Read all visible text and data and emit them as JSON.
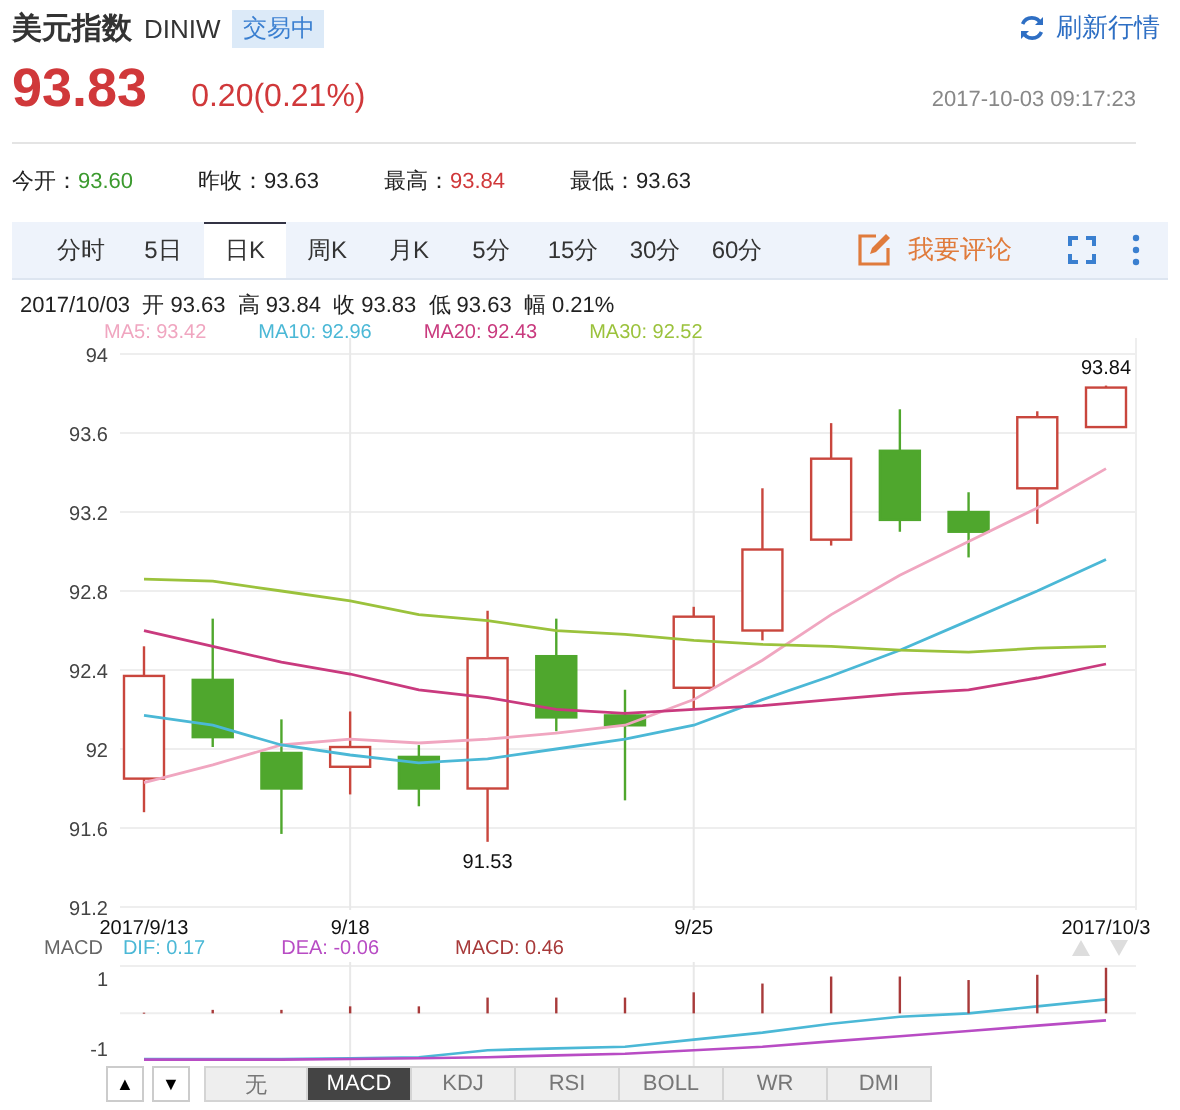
{
  "header": {
    "title": "美元指数",
    "symbol": "DINIW",
    "status": "交易中",
    "refresh": "刷新行情"
  },
  "quote": {
    "price": "93.83",
    "change": "0.20(0.21%)",
    "color": "#d0383a",
    "time": "2017-10-03 09:17:23"
  },
  "stats": [
    {
      "label": "今开：",
      "value": "93.60",
      "color": "#3b9a2e"
    },
    {
      "label": "昨收：",
      "value": "93.63",
      "color": "#222222"
    },
    {
      "label": "最高：",
      "value": "93.84",
      "color": "#d0383a"
    },
    {
      "label": "最低：",
      "value": "93.63",
      "color": "#222222"
    }
  ],
  "period_tabs": [
    {
      "label": "分时",
      "selected": false
    },
    {
      "label": "5日",
      "selected": false
    },
    {
      "label": "日K",
      "selected": true
    },
    {
      "label": "周K",
      "selected": false
    },
    {
      "label": "月K",
      "selected": false
    },
    {
      "label": "5分",
      "selected": false
    },
    {
      "label": "15分",
      "selected": false
    },
    {
      "label": "30分",
      "selected": false
    },
    {
      "label": "60分",
      "selected": false
    }
  ],
  "comment_button": "我要评论",
  "chart": {
    "info": "2017/10/03  开 93.63  高 93.84  收 93.83  低 93.63  幅 0.21%",
    "legend_values": [
      ": 93.42",
      ": 92.96",
      ": 92.43",
      ": 92.52"
    ],
    "chart_data": {
      "type": "line",
      "grid": true,
      "ylim": [
        91.2,
        94
      ],
      "yticks": [
        91.2,
        91.6,
        92,
        92.4,
        92.8,
        93.2,
        93.6,
        94
      ],
      "categories": [
        "2017/9/13",
        null,
        null,
        "9/18",
        null,
        null,
        null,
        null,
        "9/25",
        null,
        null,
        null,
        null,
        null,
        "2017/10/3"
      ],
      "series": [
        {
          "name": "MA5",
          "color": "#f0a6c0",
          "values": [
            91.83,
            91.92,
            92.02,
            92.05,
            92.03,
            92.05,
            92.08,
            92.12,
            92.25,
            92.45,
            92.68,
            92.88,
            93.05,
            93.22,
            93.42
          ]
        },
        {
          "name": "MA10",
          "color": "#4bb8d6",
          "values": [
            92.17,
            92.12,
            92.02,
            91.97,
            91.93,
            91.95,
            92.0,
            92.05,
            92.12,
            92.25,
            92.37,
            92.5,
            92.65,
            92.8,
            92.96
          ]
        },
        {
          "name": "MA20",
          "color": "#c93a7e",
          "values": [
            92.6,
            92.52,
            92.44,
            92.38,
            92.3,
            92.26,
            92.2,
            92.18,
            92.2,
            92.22,
            92.25,
            92.28,
            92.3,
            92.36,
            92.43
          ]
        },
        {
          "name": "MA30",
          "color": "#9bc23c",
          "values": [
            92.86,
            92.85,
            92.8,
            92.75,
            92.68,
            92.65,
            92.6,
            92.58,
            92.55,
            92.53,
            92.52,
            92.5,
            92.49,
            92.51,
            92.52
          ]
        },
        {
          "type": "candlestick",
          "ohlc": [
            [
              91.85,
              92.52,
              91.68,
              92.37
            ],
            [
              92.35,
              92.66,
              92.01,
              92.06
            ],
            [
              91.98,
              92.15,
              91.57,
              91.8
            ],
            [
              91.91,
              92.19,
              91.77,
              92.01
            ],
            [
              91.96,
              92.02,
              91.71,
              91.8
            ],
            [
              91.8,
              92.7,
              91.53,
              92.46
            ],
            [
              92.47,
              92.66,
              92.09,
              92.16
            ],
            [
              92.17,
              92.3,
              91.74,
              92.12
            ],
            [
              92.31,
              92.72,
              92.2,
              92.67
            ],
            [
              92.6,
              93.32,
              92.55,
              93.01
            ],
            [
              93.06,
              93.65,
              93.03,
              93.47
            ],
            [
              93.51,
              93.72,
              93.1,
              93.16
            ],
            [
              93.2,
              93.3,
              92.97,
              93.1
            ],
            [
              93.32,
              93.71,
              93.14,
              93.68
            ],
            [
              93.63,
              93.84,
              93.63,
              93.83
            ]
          ]
        }
      ],
      "annotations": [
        "93.84",
        "91.53"
      ]
    }
  },
  "indicator": {
    "name": "MACD",
    "legend_values": [
      ": 0.17",
      ": -0.06",
      ": 0.46"
    ],
    "chart_data": {
      "type": "bar",
      "grid": true,
      "ylim": [
        -1.5,
        1.35
      ],
      "yticks": [
        1,
        -1
      ],
      "series": [
        {
          "name": "DIF",
          "type": "line",
          "color": "#4bb8d6",
          "values": [
            -1.3,
            -1.3,
            -1.3,
            -1.28,
            -1.25,
            -1.05,
            -1.0,
            -0.95,
            -0.75,
            -0.55,
            -0.3,
            -0.1,
            0.0,
            0.2,
            0.4
          ]
        },
        {
          "name": "DEA",
          "type": "line",
          "color": "#b84cc4",
          "values": [
            -1.32,
            -1.32,
            -1.32,
            -1.3,
            -1.28,
            -1.25,
            -1.2,
            -1.15,
            -1.05,
            -0.95,
            -0.8,
            -0.65,
            -0.5,
            -0.35,
            -0.2
          ]
        },
        {
          "name": "MACD",
          "type": "bar",
          "color": "#a83a3a",
          "values": [
            0.02,
            0.1,
            0.1,
            0.2,
            0.2,
            0.45,
            0.45,
            0.45,
            0.6,
            0.85,
            1.05,
            1.05,
            0.95,
            1.1,
            1.3
          ]
        }
      ]
    }
  },
  "nav_buttons": [
    "▲",
    "▼"
  ],
  "indicator_tabs": [
    {
      "label": "无",
      "selected": false
    },
    {
      "label": "MACD",
      "selected": true
    },
    {
      "label": "KDJ",
      "selected": false
    },
    {
      "label": "RSI",
      "selected": false
    },
    {
      "label": "BOLL",
      "selected": false
    },
    {
      "label": "WR",
      "selected": false
    },
    {
      "label": "DMI",
      "selected": false
    }
  ]
}
